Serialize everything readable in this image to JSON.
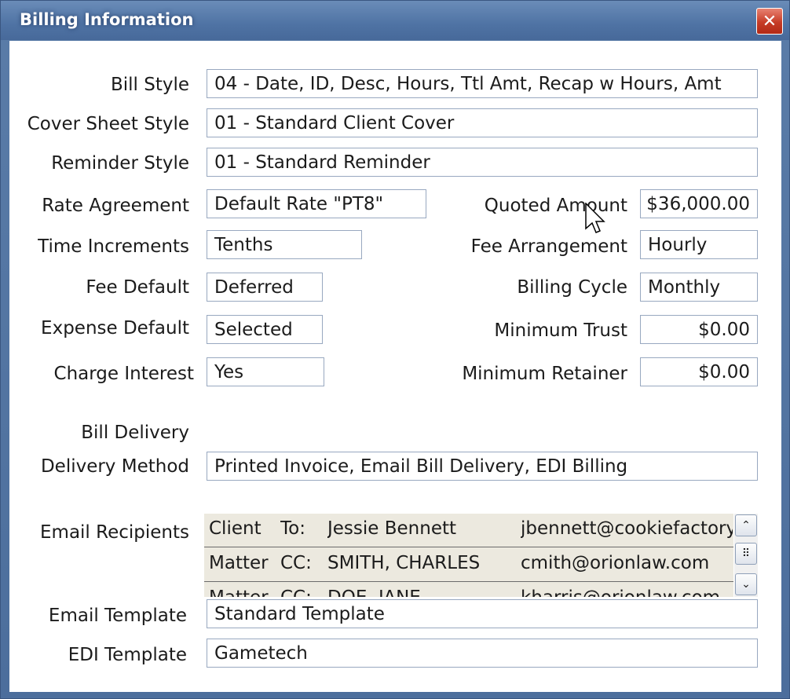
{
  "window": {
    "title": "Billing Information",
    "close_glyph": "✕"
  },
  "labels": {
    "bill_style": "Bill Style",
    "cover_sheet_style": "Cover Sheet Style",
    "reminder_style": "Reminder Style",
    "rate_agreement": "Rate Agreement",
    "time_increments": "Time Increments",
    "fee_default": "Fee Default",
    "expense_default": "Expense Default",
    "charge_interest": "Charge Interest",
    "quoted_amount": "Quoted Amount",
    "fee_arrangement": "Fee Arrangement",
    "billing_cycle": "Billing Cycle",
    "minimum_trust": "Minimum Trust",
    "minimum_retainer": "Minimum Retainer",
    "bill_delivery": "Bill Delivery",
    "delivery_method": "Delivery Method",
    "email_recipients": "Email Recipients",
    "email_template": "Email Template",
    "edi_template": "EDI Template"
  },
  "values": {
    "bill_style": "04 - Date, ID, Desc, Hours, Ttl Amt, Recap w Hours, Amt",
    "cover_sheet_style": "01 - Standard Client Cover",
    "reminder_style": "01 - Standard Reminder",
    "rate_agreement": "Default Rate \"PT8\"",
    "time_increments": "Tenths",
    "fee_default": "Deferred",
    "expense_default": "Selected",
    "charge_interest": "Yes",
    "quoted_amount": "$36,000.00",
    "fee_arrangement": "Hourly",
    "billing_cycle": "Monthly",
    "minimum_trust": "$0.00",
    "minimum_retainer": "$0.00",
    "delivery_method": "Printed Invoice, Email Bill Delivery, EDI Billing",
    "email_template": "Standard Template",
    "edi_template": "Gametech"
  },
  "email_recipients": [
    {
      "type": "Client",
      "kind": "To:",
      "name": "Jessie Bennett",
      "email": "jbennett@cookiefactory"
    },
    {
      "type": "Matter",
      "kind": "CC:",
      "name": "SMITH, CHARLES",
      "email": "cmith@orionlaw.com"
    },
    {
      "type": "Matter",
      "kind": "CC:",
      "name": "DOE, JANE",
      "email": "kharris@orionlaw.com"
    }
  ],
  "scrollbar": {
    "up_glyph": "⌃",
    "grip_glyph": "⠿",
    "down_glyph": "⌄"
  },
  "colors": {
    "titlebar": "#4f73a4",
    "close_button": "#c63b26",
    "grid_background": "#ece9df"
  }
}
